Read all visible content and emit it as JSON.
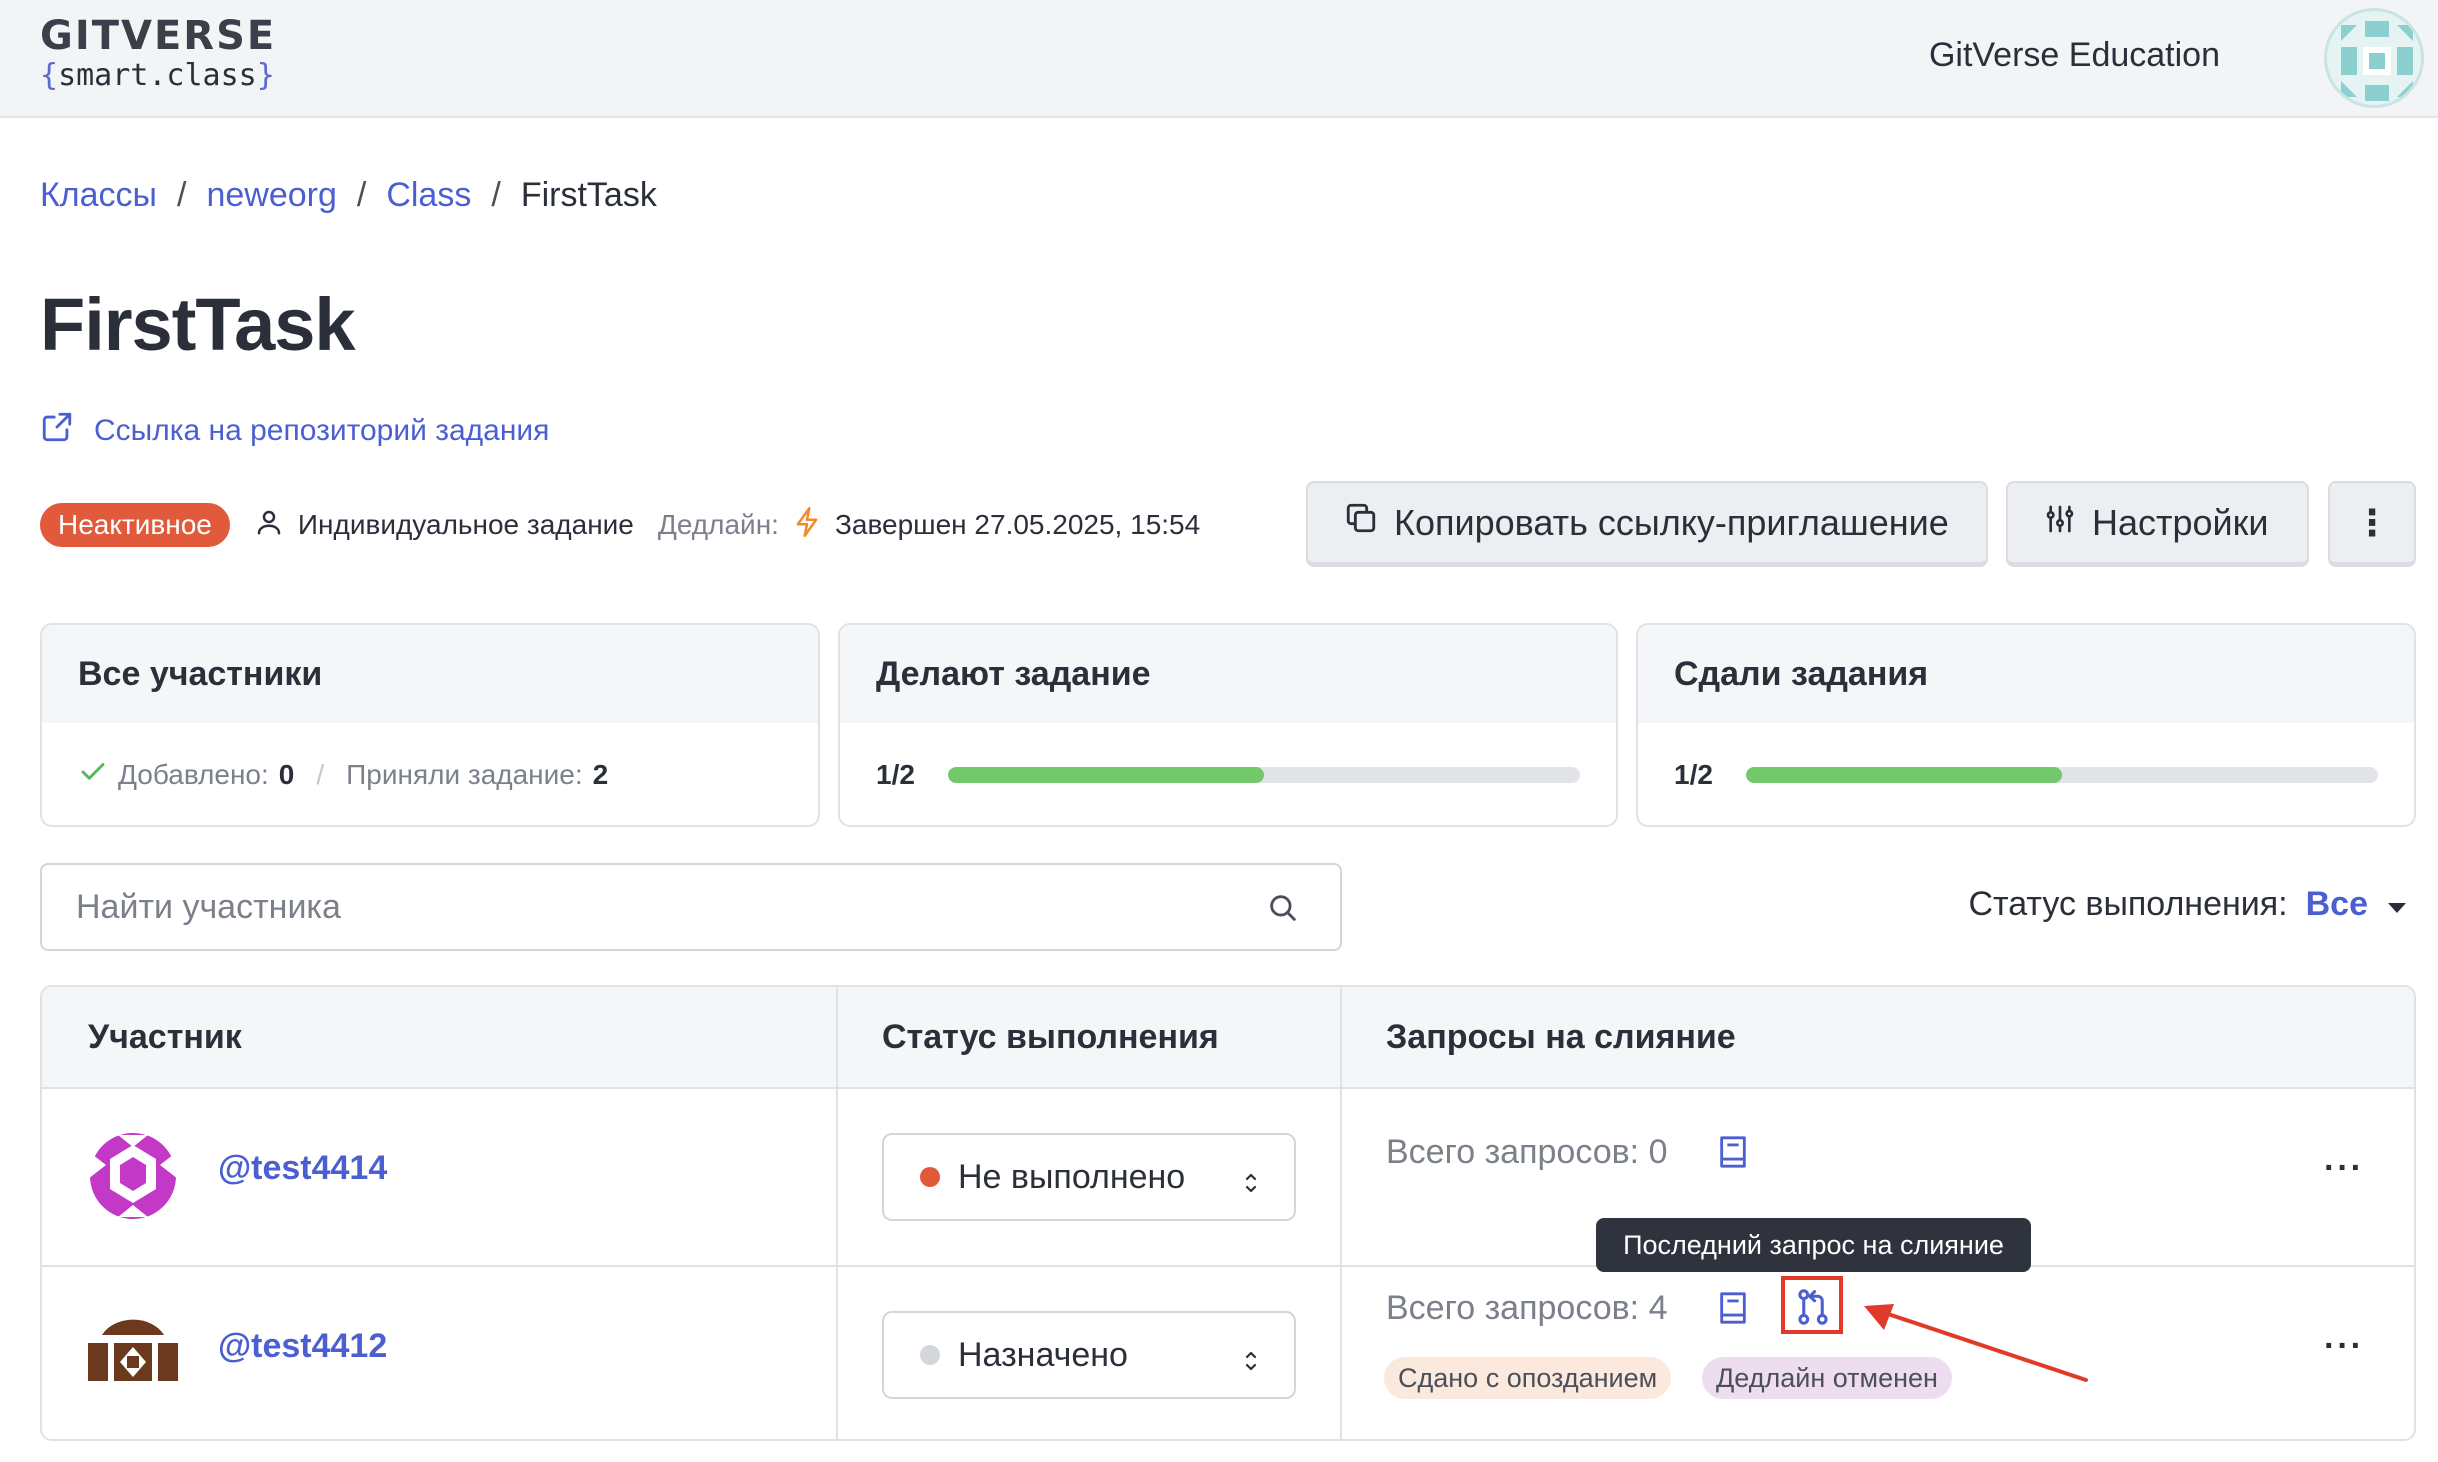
{
  "header": {
    "logo_main": "GITVERSE",
    "logo_sub_open": "{",
    "logo_sub_text": "smart.class",
    "logo_sub_close": "}",
    "org_name": "GitVerse Education"
  },
  "breadcrumb": {
    "items": [
      "Классы",
      "neweorg",
      "Class",
      "FirstTask"
    ],
    "separator": "/"
  },
  "page": {
    "title": "FirstTask",
    "repo_link": "Ссылка на репозиторий задания"
  },
  "meta": {
    "status_badge": "Неактивное",
    "assignment_type": "Индивидуальное задание",
    "deadline_label": "Дедлайн:",
    "deadline_value": "Завершен 27.05.2025, 15:54"
  },
  "toolbar": {
    "copy_invite": "Копировать ссылку-приглашение",
    "settings": "Настройки",
    "more": "⋮"
  },
  "cards": {
    "participants": {
      "title": "Все участники",
      "added_label": "Добавлено:",
      "added_value": "0",
      "accepted_label": "Приняли задание:",
      "accepted_value": "2",
      "sep": "/"
    },
    "doing": {
      "title": "Делают задание",
      "progress_text": "1/2",
      "progress": 0.5
    },
    "submitted": {
      "title": "Сдали задания",
      "progress_text": "1/2",
      "progress": 0.5
    }
  },
  "search": {
    "placeholder": "Найти участника"
  },
  "filter": {
    "label": "Статус выполнения:",
    "value": "Все"
  },
  "table": {
    "headers": [
      "Участник",
      "Статус выполнения",
      "Запросы на слияние"
    ],
    "rows": [
      {
        "name": "@test4414",
        "status": "Не выполнено",
        "status_color": "#e05a3a",
        "requests": "Всего запросов: 0",
        "more": "···"
      },
      {
        "name": "@test4412",
        "status": "Назначено",
        "status_color": "#d3d6db",
        "requests": "Всего запросов: 4",
        "more": "···",
        "tags": [
          "Сдано с опозданием",
          "Дедлайн отменен"
        ]
      }
    ]
  },
  "tooltip": {
    "text": "Последний запрос на слияние"
  },
  "colors": {
    "accent": "#4b5fd0",
    "danger": "#e25a3c",
    "progress": "#72c86a",
    "annotation": "#e03a2a"
  },
  "icons": [
    "external-link-icon",
    "user-icon",
    "lightning-icon",
    "copy-icon",
    "sliders-icon",
    "kebab-icon",
    "check-icon",
    "search-icon",
    "caret-down-icon",
    "book-icon",
    "pull-request-icon",
    "sort-icon"
  ]
}
